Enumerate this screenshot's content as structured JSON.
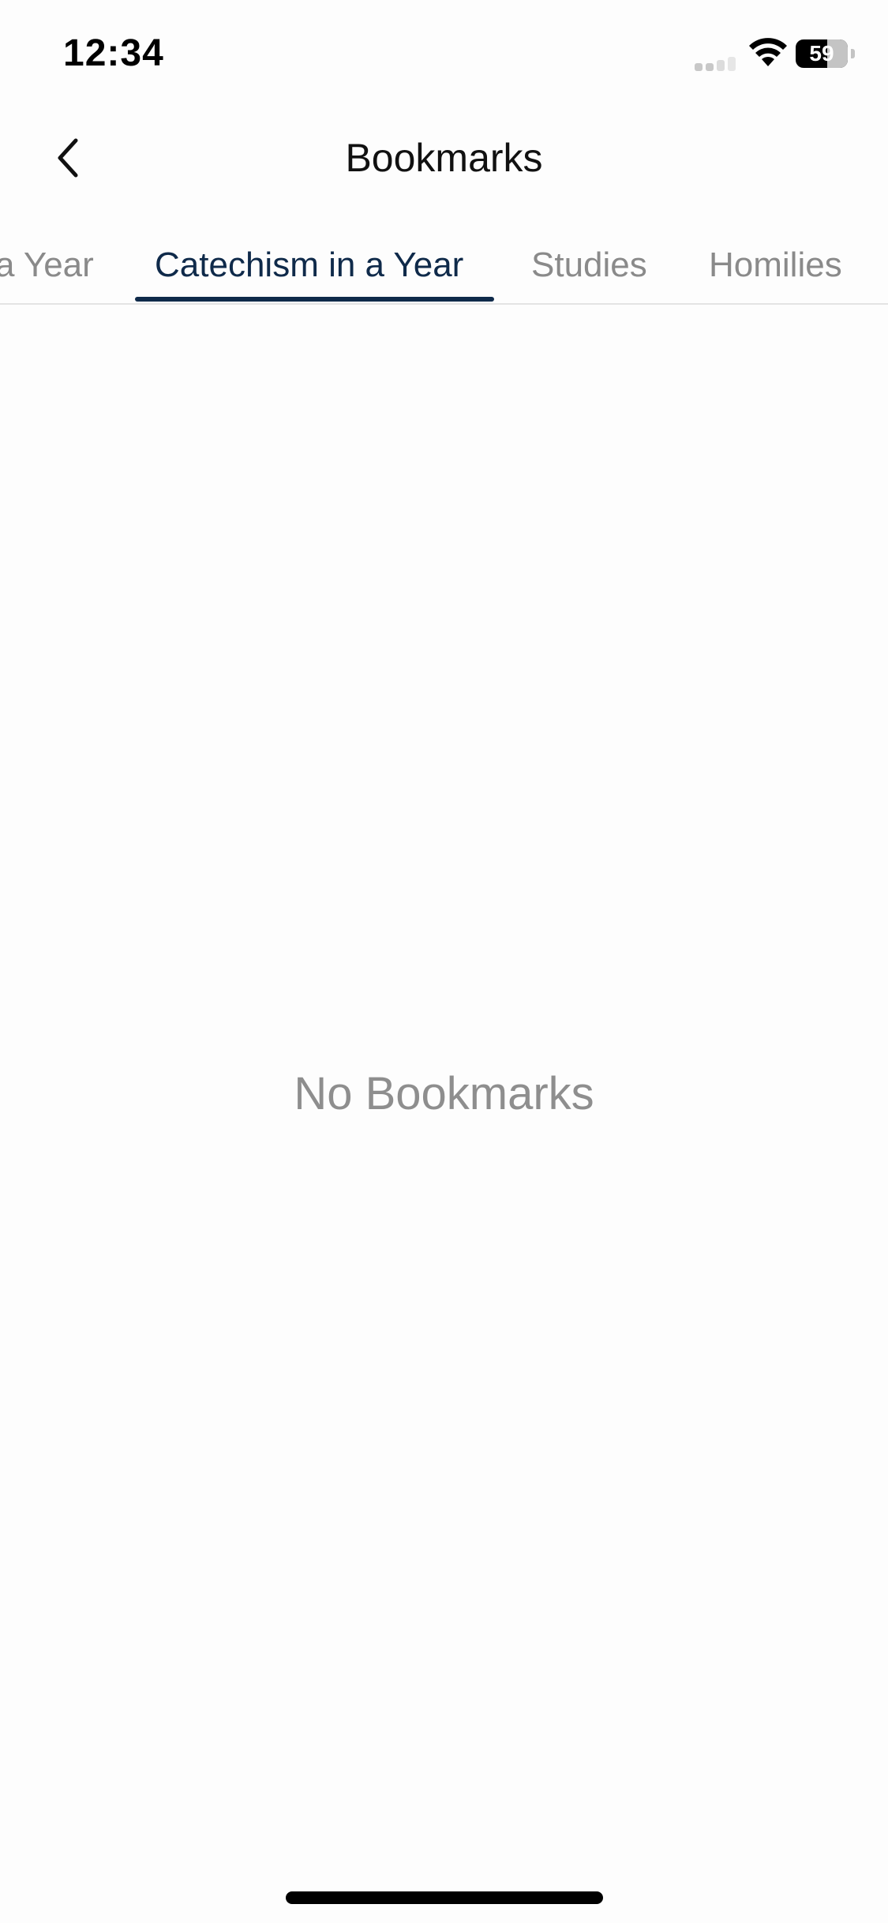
{
  "status_bar": {
    "time": "12:34",
    "battery_level": "59",
    "battery_percent": 59,
    "icons": [
      "signal-icon",
      "wifi-icon",
      "battery-icon"
    ]
  },
  "header": {
    "title": "Bookmarks",
    "back_icon": "chevron-left-icon"
  },
  "tabs": [
    {
      "label": "a Year",
      "active": false
    },
    {
      "label": "Catechism in a Year",
      "active": true
    },
    {
      "label": "Studies",
      "active": false
    },
    {
      "label": "Homilies",
      "active": false
    }
  ],
  "empty_state": {
    "message": "No Bookmarks"
  },
  "colors": {
    "accent": "#0f2a4a",
    "inactive_tab": "#8a8a8a",
    "empty_text": "#8e8e8e",
    "background": "#fdfdfd"
  }
}
